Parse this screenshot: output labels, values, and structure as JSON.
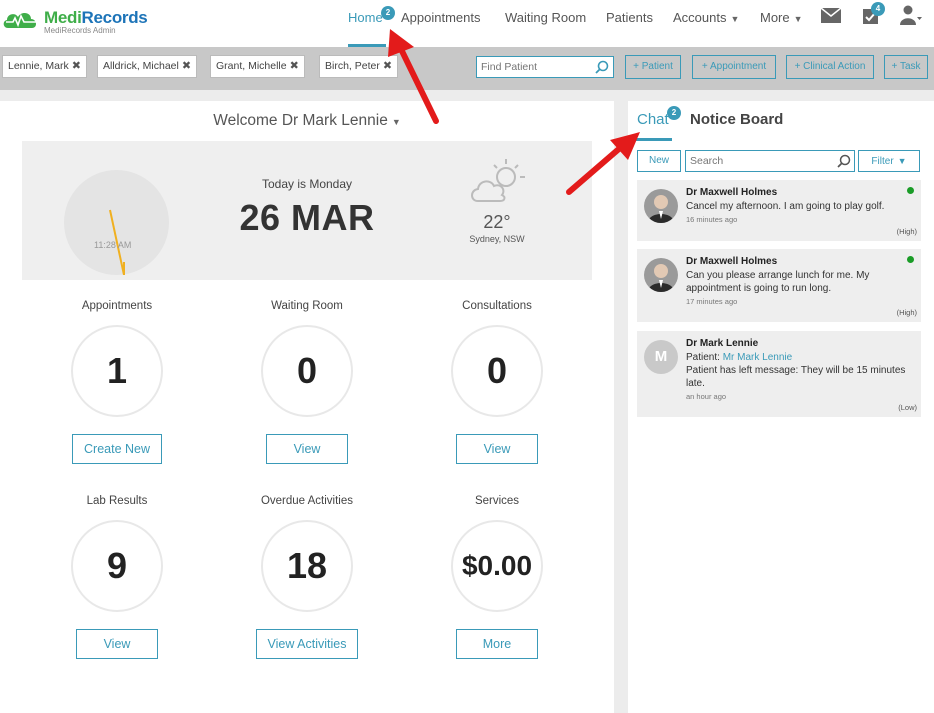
{
  "app": {
    "brand_part1": "Medi",
    "brand_part2": "Records",
    "subtitle": "MediRecords Admin"
  },
  "nav": {
    "home": "Home",
    "home_badge": "2",
    "appointments": "Appointments",
    "waiting_room": "Waiting Room",
    "patients": "Patients",
    "accounts": "Accounts",
    "more": "More",
    "tasks_badge": "4",
    "icons": [
      "mail-icon",
      "tasks-icon",
      "user-icon"
    ]
  },
  "patient_tabs": [
    {
      "name": "Lennie, Mark"
    },
    {
      "name": "Alldrick, Michael"
    },
    {
      "name": "Grant, Michelle"
    },
    {
      "name": "Birch, Peter"
    }
  ],
  "toolbar": {
    "find_placeholder": "Find Patient",
    "add_patient": "+ Patient",
    "add_appointment": "+ Appointment",
    "add_clinical_action": "+ Clinical Action",
    "add_task": "+ Task"
  },
  "welcome": "Welcome Dr Mark Lennie",
  "hero": {
    "clock_time": "11:28 AM",
    "today": "Today is Monday",
    "date": "26 MAR",
    "temperature": "22°",
    "location": "Sydney, NSW"
  },
  "stats": [
    {
      "label": "Appointments",
      "value": "1",
      "button": "Create New"
    },
    {
      "label": "Waiting Room",
      "value": "0",
      "button": "View"
    },
    {
      "label": "Consultations",
      "value": "0",
      "button": "View"
    },
    {
      "label": "Lab Results",
      "value": "9",
      "button": "View"
    },
    {
      "label": "Overdue Activities",
      "value": "18",
      "button": "View Activities"
    },
    {
      "label": "Services",
      "value": "$0.00",
      "button": "More"
    }
  ],
  "chat": {
    "tab_chat": "Chat",
    "chat_badge": "2",
    "tab_notice": "Notice Board",
    "new_label": "New",
    "search_placeholder": "Search",
    "filter_label": "Filter",
    "messages": [
      {
        "from": "Dr Maxwell Holmes",
        "text": "Cancel my afternoon. I am going to play golf.",
        "time": "16 minutes ago",
        "priority": "(High)"
      },
      {
        "from": "Dr Maxwell Holmes",
        "text": "Can you please arrange lunch for me. My appointment is going to run long.",
        "time": "17 minutes ago",
        "priority": "(High)"
      },
      {
        "from": "Dr Mark Lennie",
        "avatar_letter": "M",
        "patient_prefix": "Patient:",
        "patient_link": "Mr Mark Lennie",
        "text": "Patient has left message: They will be 15 minutes late.",
        "time": "an hour ago",
        "priority": "(Low)"
      }
    ]
  },
  "colors": {
    "accent": "#3a9ab8",
    "brand_green": "#3fae49",
    "brand_blue": "#1d74b8",
    "online": "#1a9c27",
    "arrow": "#e31b1b",
    "clock_hand": "#f0b020"
  }
}
